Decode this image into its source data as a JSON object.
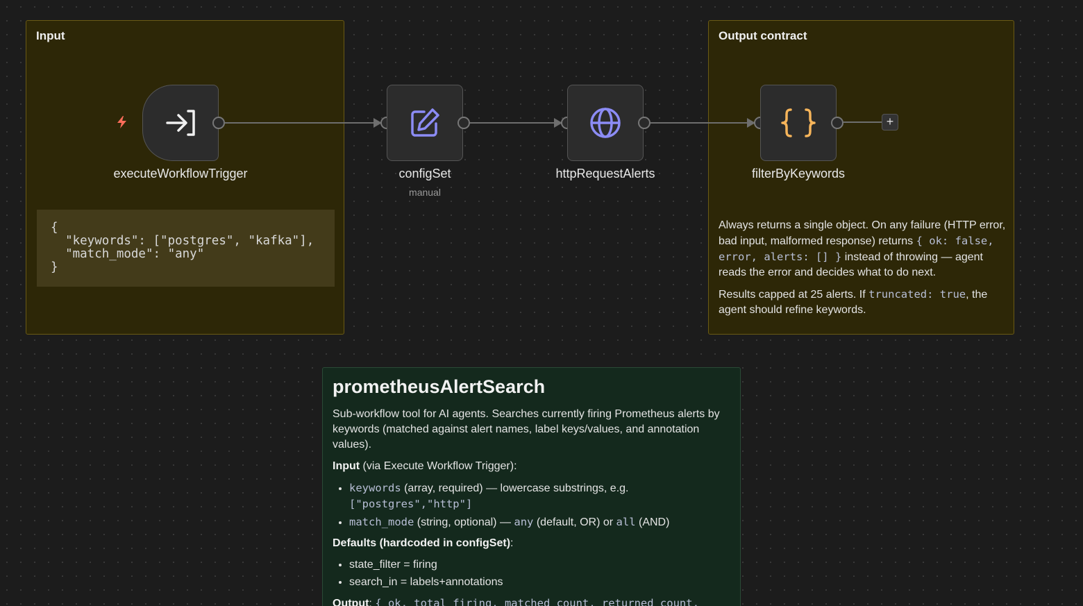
{
  "input_note": {
    "title": "Input",
    "code": "{\n  \"keywords\": [\"postgres\", \"kafka\"],\n  \"match_mode\": \"any\"\n}"
  },
  "output_note": {
    "title": "Output contract",
    "p1_a": "Always returns a single object. On any failure (HTTP error, bad input, malformed response) returns ",
    "p1_code": "{ ok: false, error, alerts: [] }",
    "p1_b": " instead of throwing — agent reads the error and decides what to do next.",
    "p2_a": "Results capped at 25 alerts. If ",
    "p2_code": "truncated: true",
    "p2_b": ", the agent should refine keywords."
  },
  "nodes": {
    "trigger": {
      "label": "executeWorkflowTrigger"
    },
    "config": {
      "label": "configSet",
      "sublabel": "manual"
    },
    "http": {
      "label": "httpRequestAlerts"
    },
    "filter": {
      "label": "filterByKeywords"
    }
  },
  "add_button": {
    "label": "+"
  },
  "description": {
    "title": "prometheusAlertSearch",
    "intro": "Sub-workflow tool for AI agents. Searches currently firing Prometheus alerts by keywords (matched against alert names, label keys/values, and annotation values).",
    "input_heading": "Input",
    "input_heading_rest": " (via Execute Workflow Trigger):",
    "input_items": [
      {
        "code": "keywords",
        "text": " (array, required) — lowercase substrings, e.g. ",
        "code2": "[\"postgres\",\"http\"]"
      },
      {
        "code": "match_mode",
        "text": " (string, optional) — ",
        "code2": "any",
        "text2": " (default, OR) or ",
        "code3": "all",
        "text3": " (AND)"
      }
    ],
    "defaults_heading": "Defaults (hardcoded in configSet)",
    "defaults_heading_rest": ":",
    "defaults_items": [
      "state_filter = firing",
      "search_in = labels+annotations"
    ],
    "output_heading": "Output",
    "output_heading_rest": ": ",
    "output_code": "{ ok, total_firing, matched_count, returned_count,"
  },
  "colors": {
    "trigger_bolt": "#ff6d5a",
    "config_icon": "#8c8cf5",
    "http_icon": "#8c8cf5",
    "filter_icon": "#f5b45a"
  }
}
